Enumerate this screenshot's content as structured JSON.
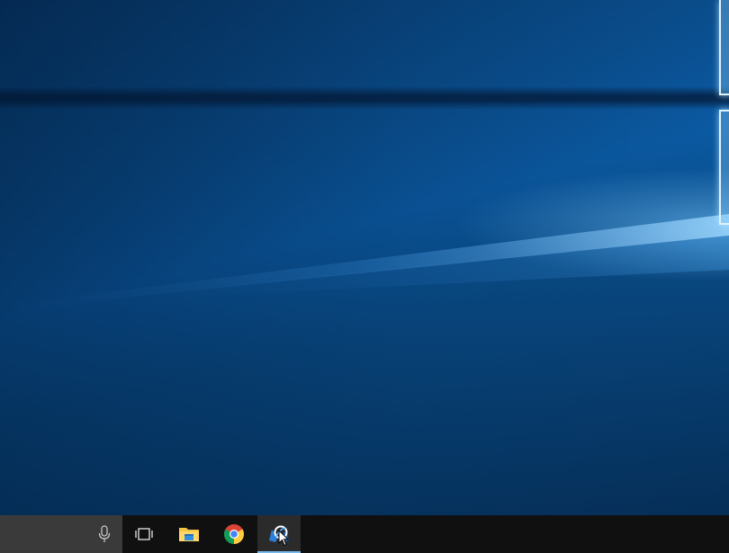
{
  "desktop": {
    "wallpaper": "windows-10-hero-wallpaper",
    "accent_color": "#0b5aa3",
    "glow_color": "#dff3ff"
  },
  "taskbar": {
    "background_color": "#101010",
    "search_box": {
      "background_color": "#3a3a3a",
      "icon": "microphone-icon"
    },
    "items": [
      {
        "name": "task-view",
        "icon": "task-view-icon",
        "active": false
      },
      {
        "name": "file-explorer",
        "icon": "folder-icon",
        "active": false
      },
      {
        "name": "google-chrome",
        "icon": "chrome-icon",
        "active": false
      },
      {
        "name": "app",
        "icon": "app-icon",
        "active": true
      }
    ],
    "active_indicator_color": "#76b9ed"
  },
  "cursor": {
    "icon": "mouse-pointer-icon"
  }
}
